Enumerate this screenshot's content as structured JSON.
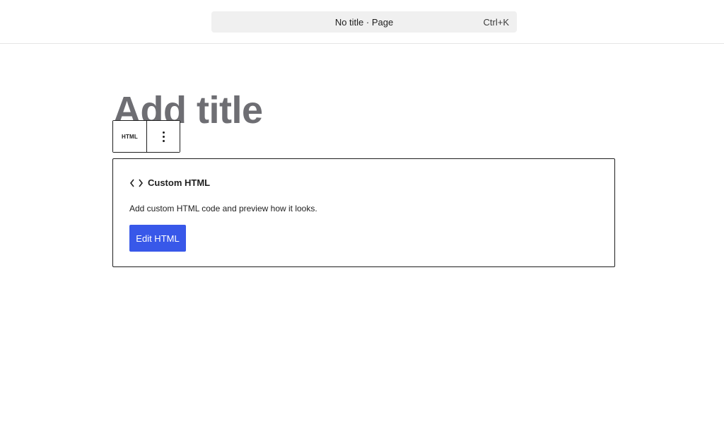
{
  "header": {
    "document_title": "No title · Page",
    "shortcut": "Ctrl+K"
  },
  "editor": {
    "title_placeholder": "Add title"
  },
  "block_toolbar": {
    "block_type_label": "HTML",
    "options_icon": "vertical-ellipsis-icon"
  },
  "html_block": {
    "icon": "code-brackets-icon",
    "name": "Custom HTML",
    "description": "Add custom HTML code and preview how it looks.",
    "edit_button_label": "Edit HTML"
  },
  "colors": {
    "accent": "#3858e9",
    "title_placeholder": "#6e6e73",
    "command_bar_bg": "#f0f0f0"
  }
}
